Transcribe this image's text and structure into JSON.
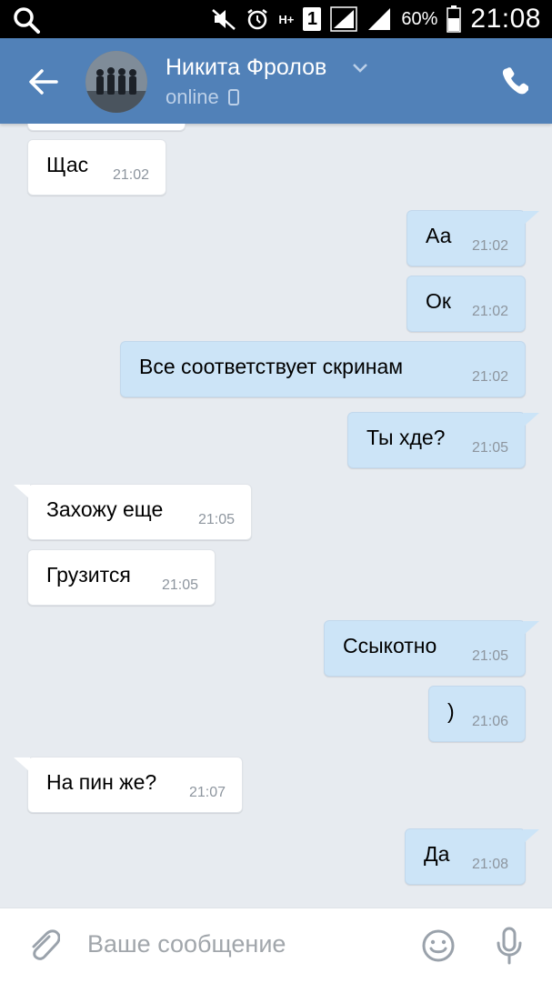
{
  "status_bar": {
    "network_label": "H+",
    "sim_number": "1",
    "battery_percent": "60%",
    "time": "21:08"
  },
  "header": {
    "contact_name": "Никита Фролов",
    "presence": "online",
    "icons": [
      "back-arrow-icon",
      "chevron-down-icon",
      "mobile-device-icon",
      "phone-icon"
    ]
  },
  "messages": [
    {
      "side": "in",
      "text": "Щас",
      "time": "21:02"
    },
    {
      "side": "out",
      "text": "Аа",
      "time": "21:02"
    },
    {
      "side": "out",
      "text": "Ок",
      "time": "21:02"
    },
    {
      "side": "out",
      "text": "Все соответствует скринам",
      "time": "21:02"
    },
    {
      "side": "out",
      "text": "Ты хде?",
      "time": "21:05"
    },
    {
      "side": "in",
      "text": "Захожу еще",
      "time": "21:05"
    },
    {
      "side": "in",
      "text": "Грузится",
      "time": "21:05"
    },
    {
      "side": "out",
      "text": "Ссыкотно",
      "time": "21:05"
    },
    {
      "side": "out",
      "text": ")",
      "time": "21:06"
    },
    {
      "side": "in",
      "text": "На пин же?",
      "time": "21:07"
    },
    {
      "side": "out",
      "text": "Да",
      "time": "21:08"
    }
  ],
  "composer": {
    "placeholder": "Ваше сообщение",
    "icons": [
      "paperclip-icon",
      "smile-icon",
      "microphone-icon"
    ]
  },
  "colors": {
    "header": "#5181b8",
    "background": "#e7ebf0",
    "outgoing_bubble": "#cce4f7",
    "incoming_bubble": "#ffffff"
  }
}
